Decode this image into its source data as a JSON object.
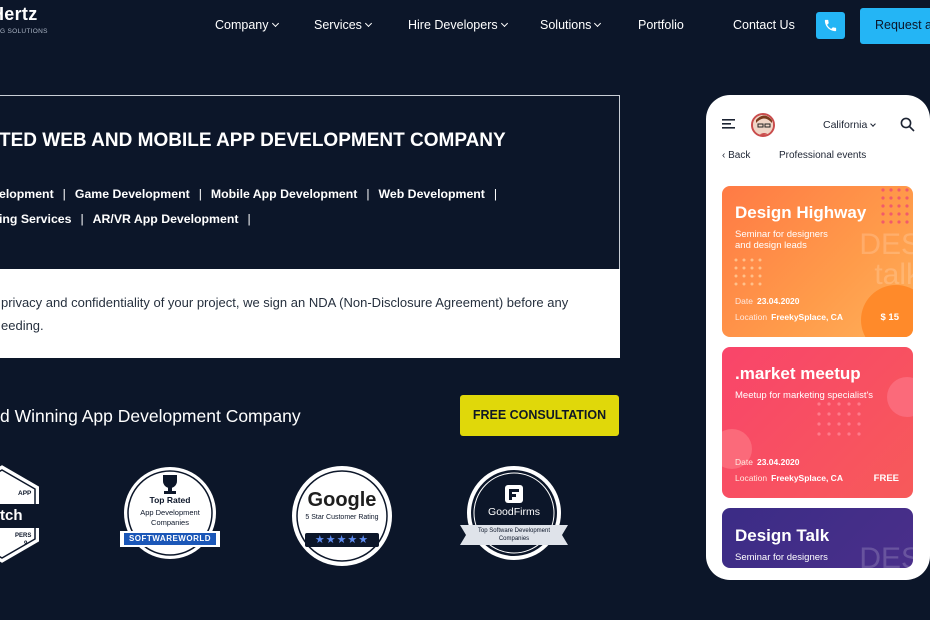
{
  "header": {
    "logo_name": "Hertz",
    "logo_sub": "G SOLUTIONS",
    "nav": [
      "Company",
      "Services",
      "Hire Developers",
      "Solutions",
      "Portfolio",
      "Contact Us"
    ],
    "request_label": "Request a"
  },
  "hero": {
    "title": "TED WEB AND MOBILE APP DEVELOPMENT COMPANY",
    "services_row1": [
      "elopment",
      "Game Development",
      "Mobile App Development",
      "Web Development"
    ],
    "services_row2": [
      "ing Services",
      "AR/VR App Development"
    ],
    "separator": "|",
    "nda_line1": "privacy and confidentiality of your project, we sign an NDA (Non-Disclosure Agreement) before any",
    "nda_line2": "eeding."
  },
  "award": {
    "title": "d Winning App Development Company",
    "cta_label": "FREE CONSULTATION"
  },
  "badges": {
    "clutch": {
      "top": "APP",
      "main": "tch",
      "bottom": "PERS",
      "year": "9"
    },
    "softwareworld": {
      "top": "Top Rated",
      "middle": "App Development Companies",
      "ribbon": "SOFTWAREWORLD"
    },
    "google": {
      "name": "Google",
      "caption": "5 Star Customer Rating",
      "stars": "★★★★★"
    },
    "goodfirms": {
      "name": "GoodFirms",
      "ribbon": "Top Software Development Companies"
    }
  },
  "phone": {
    "location": "California",
    "back_label": "Back",
    "section_title": "Professional events",
    "date_label": "Date",
    "location_label": "Location",
    "cards": [
      {
        "title": "Design Highway",
        "subtitle_1": "Seminar for designers",
        "subtitle_2": "and design leads",
        "bg_text_1": "DES",
        "bg_text_2": "talk",
        "date": "23.04.2020",
        "location": "FreekySplace, CA",
        "price": "$ 15"
      },
      {
        "title": ".market meetup",
        "subtitle_1": "Meetup for marketing specialist's",
        "subtitle_2": "",
        "date": "23.04.2020",
        "location": "FreekySplace, CA",
        "price": "FREE"
      },
      {
        "title": "Design Talk",
        "subtitle_1": "Seminar for designers",
        "bg_text_1": "DES"
      }
    ]
  },
  "colors": {
    "background": "#0c1629",
    "accent_blue": "#24b5f5",
    "cta_yellow": "#e0d80a",
    "card_orange": "#ff8a3d",
    "card_pink": "#f9456a",
    "card_purple": "#3b2c86"
  }
}
